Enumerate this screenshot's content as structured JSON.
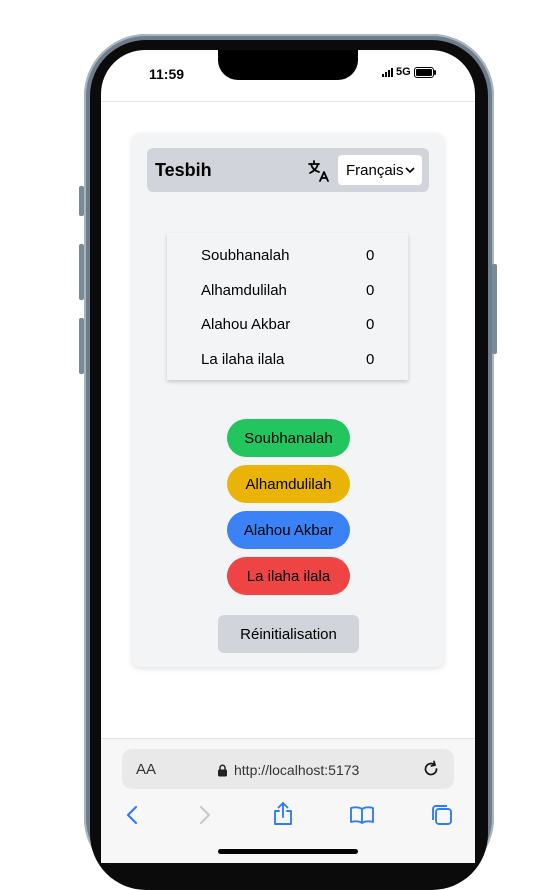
{
  "status": {
    "time": "11:59",
    "network": "5G"
  },
  "app": {
    "title": "Tesbih",
    "language": "Français",
    "counters": [
      {
        "label": "Soubhanalah",
        "value": "0"
      },
      {
        "label": "Alhamdulilah",
        "value": "0"
      },
      {
        "label": "Alahou Akbar",
        "value": "0"
      },
      {
        "label": "La ilaha ilala",
        "value": "0"
      }
    ],
    "buttons": [
      {
        "label": "Soubhanalah",
        "color": "#22c55e"
      },
      {
        "label": "Alhamdulilah",
        "color": "#eab308"
      },
      {
        "label": "Alahou Akbar",
        "color": "#3b82f6"
      },
      {
        "label": "La ilaha ilala",
        "color": "#ef4444"
      }
    ],
    "reset_label": "Réinitialisation"
  },
  "browser": {
    "text_size_label": "AA",
    "url": "http://localhost:5173",
    "icons": [
      "back-icon",
      "forward-icon",
      "share-icon",
      "bookmarks-icon",
      "tabs-icon",
      "reload-icon",
      "lock-icon",
      "translate-icon"
    ]
  }
}
